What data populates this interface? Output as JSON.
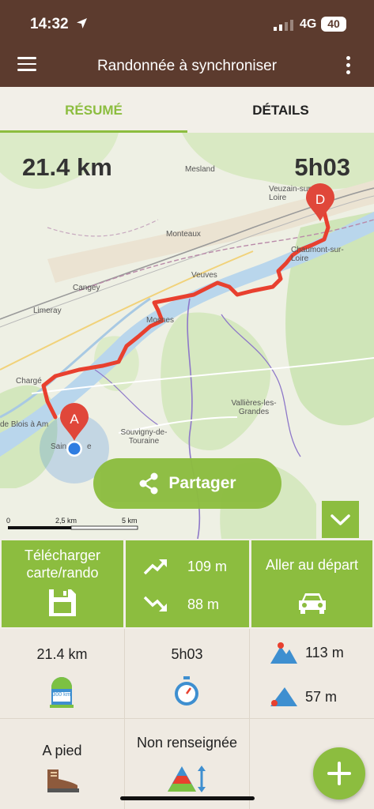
{
  "status_bar": {
    "time": "14:32",
    "network": "4G",
    "battery": "40"
  },
  "app_bar": {
    "title": "Randonnée à synchroniser"
  },
  "tabs": [
    {
      "label": "RÉSUMÉ",
      "active": true
    },
    {
      "label": "DÉTAILS",
      "active": false
    }
  ],
  "map": {
    "distance": "21.4 km",
    "duration": "5h03",
    "start_marker": "A",
    "end_marker": "D",
    "places": [
      "Mesland",
      "Veuzain-sur-Loire",
      "Monteaux",
      "Chaumont-sur-Loire",
      "Veuves",
      "Cangey",
      "Limeray",
      "Mosnes",
      "Chargé",
      "Vallières-les-Grandes",
      "Souvigny-de-Touraine",
      "de Blois à Am",
      "Sain",
      "e"
    ],
    "share_label": "Partager",
    "scale": [
      "0",
      "2,5 km",
      "5 km"
    ],
    "route_color": "#e8402f",
    "accent": "#8cbd3f"
  },
  "actions": {
    "download_label": "Télécharger carte/rando",
    "ascent": "109 m",
    "descent": "88 m",
    "go_start_label": "Aller au départ"
  },
  "stats": {
    "distance": "21.4 km",
    "duration": "5h03",
    "max_alt": "113 m",
    "min_alt": "57 m",
    "activity": "A pied",
    "difficulty": "Non renseignée",
    "milestone_badge": "300 km"
  }
}
